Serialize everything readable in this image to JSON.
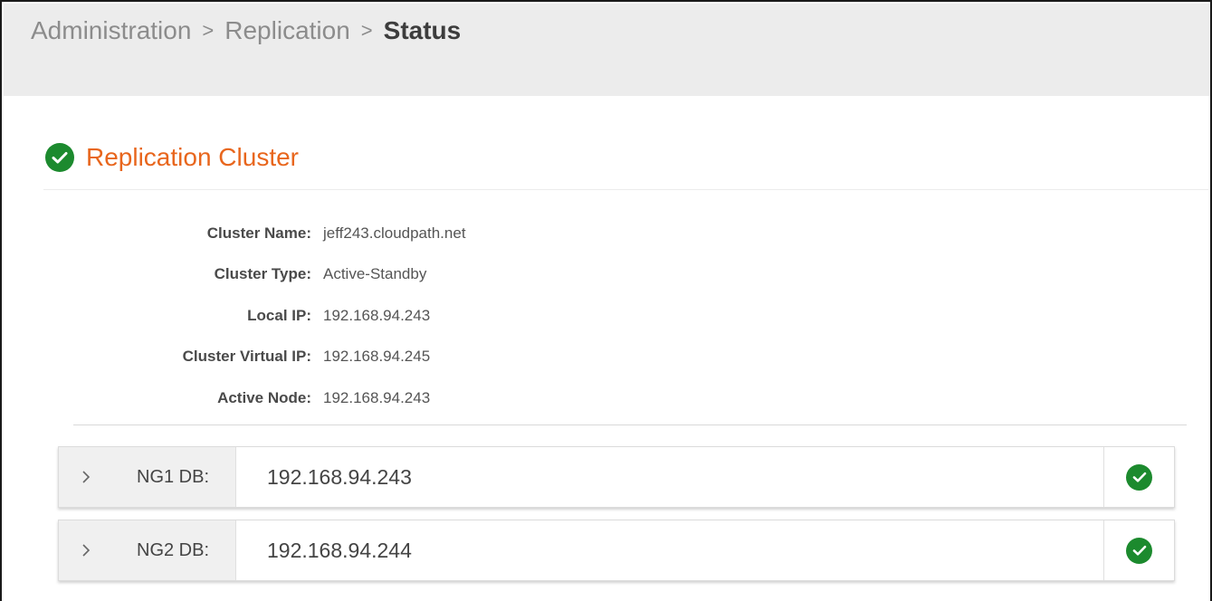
{
  "breadcrumb": {
    "items": [
      "Administration",
      "Replication"
    ],
    "separator": ">",
    "current": "Status"
  },
  "section": {
    "title": "Replication Cluster",
    "status_icon": "check-circle-icon",
    "status_color": "#1c8a2e",
    "title_color": "#e8661d"
  },
  "cluster_info": {
    "cluster_name": {
      "label": "Cluster Name:",
      "value": "jeff243.cloudpath.net"
    },
    "cluster_type": {
      "label": "Cluster Type:",
      "value": "Active-Standby"
    },
    "local_ip": {
      "label": "Local IP:",
      "value": "192.168.94.243"
    },
    "virtual_ip": {
      "label": "Cluster Virtual IP:",
      "value": "192.168.94.245"
    },
    "active_node": {
      "label": "Active Node:",
      "value": "192.168.94.243"
    }
  },
  "db_nodes": [
    {
      "label": "NG1 DB:",
      "ip": "192.168.94.243",
      "status": "ok",
      "status_icon": "check-circle-icon",
      "expand_icon": "chevron-right-icon"
    },
    {
      "label": "NG2 DB:",
      "ip": "192.168.94.244",
      "status": "ok",
      "status_icon": "check-circle-icon",
      "expand_icon": "chevron-right-icon"
    }
  ]
}
